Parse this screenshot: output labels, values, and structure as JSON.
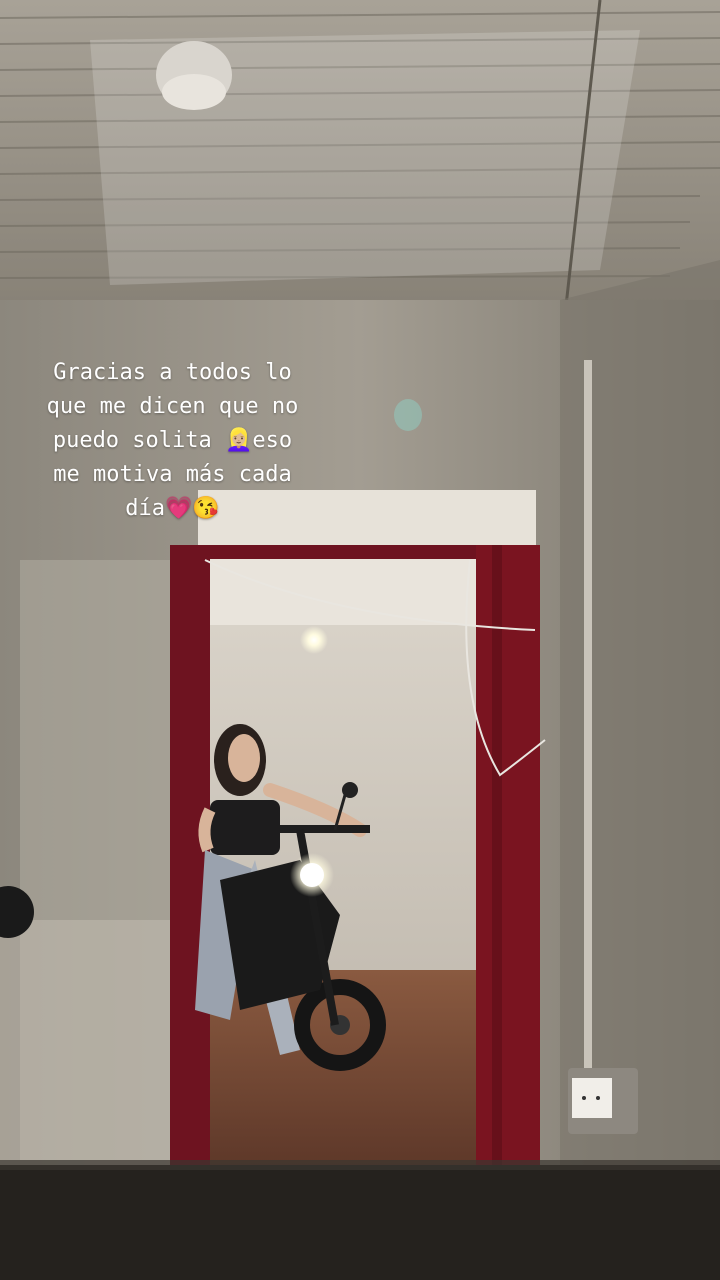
{
  "story": {
    "caption_lines": [
      "Gracias a todos lo",
      "que me dicen que no",
      "puedo solita 👱🏼‍♀️eso",
      "me motiva más cada",
      "día💗😘"
    ]
  },
  "colors": {
    "door_frame": "#7a1420",
    "wall": "#9b958a",
    "floor": "#7a4a33"
  }
}
